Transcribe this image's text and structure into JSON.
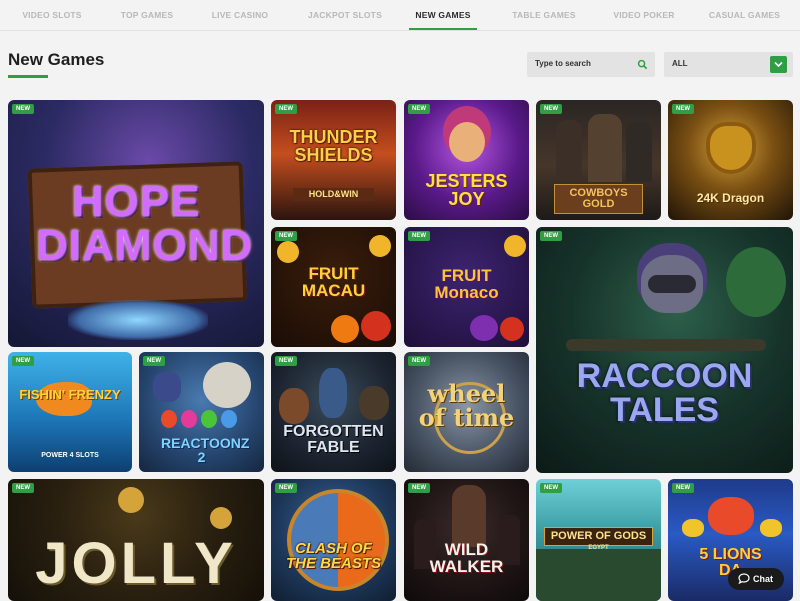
{
  "nav": {
    "tabs": [
      {
        "label": "VIDEO SLOTS"
      },
      {
        "label": "TOP GAMES"
      },
      {
        "label": "LIVE CASINO"
      },
      {
        "label": "JACKPOT SLOTS"
      },
      {
        "label": "NEW GAMES",
        "active": true
      },
      {
        "label": "TABLE GAMES"
      },
      {
        "label": "VIDEO POKER"
      },
      {
        "label": "CASUAL GAMES"
      }
    ]
  },
  "page": {
    "title": "New Games"
  },
  "search": {
    "placeholder": "Type to search"
  },
  "filter": {
    "selected": "ALL"
  },
  "badge_label": "NEW",
  "games": [
    {
      "title": "HOPE DIAMOND"
    },
    {
      "title": "THUNDER SHIELDS",
      "subtitle": "HOLD&WIN"
    },
    {
      "title": "JESTERS JOY"
    },
    {
      "title": "COWBOYS GOLD"
    },
    {
      "title": "24K Dragon"
    },
    {
      "title": "FRUIT MACAU"
    },
    {
      "title": "FRUIT Monaco"
    },
    {
      "title": "RACCOON TALES"
    },
    {
      "title": "FISHIN' FRENZY",
      "subtitle": "POWER 4 SLOTS"
    },
    {
      "title": "REACTOONZ 2"
    },
    {
      "title": "FORGOTTEN FABLE"
    },
    {
      "title": "wheel of time"
    },
    {
      "title": "JOLLY"
    },
    {
      "title": "CLASH OF THE BEASTS"
    },
    {
      "title": "WILD WALKER"
    },
    {
      "title": "POWER OF GODS",
      "subtitle": "EGYPT"
    },
    {
      "title": "5 LIONS DA"
    }
  ],
  "chat": {
    "label": "Chat"
  },
  "colors": {
    "accent": "#2f9e44",
    "background": "#f3f3f3"
  }
}
